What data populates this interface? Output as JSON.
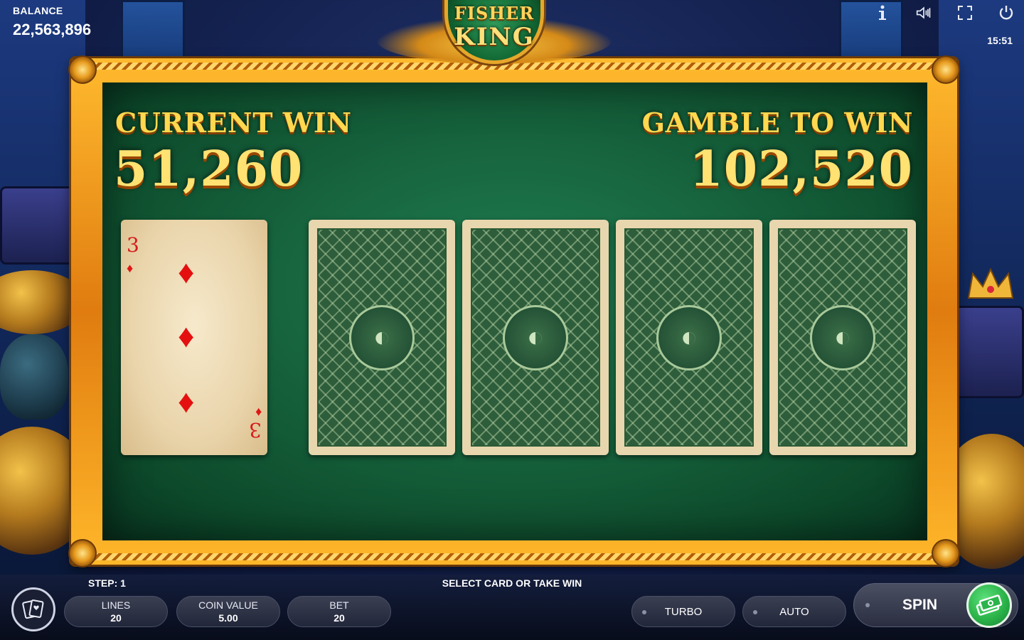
{
  "hud": {
    "balance_label": "BALANCE",
    "balance_value": "22,563,896",
    "clock": "15:51",
    "icons": [
      "info-icon",
      "sound-icon",
      "fullscreen-icon",
      "power-icon"
    ]
  },
  "logo": {
    "line1": "FISHER",
    "line2": "KING"
  },
  "gamble": {
    "current_win_label": "CURRENT WIN",
    "current_win_value": "51,260",
    "gamble_to_win_label": "GAMBLE TO WIN",
    "gamble_to_win_value": "102,520"
  },
  "dealer_card": {
    "rank": "3",
    "suit": "♦",
    "suit_name": "diamonds"
  },
  "hidden_cards_count": 4,
  "bottom": {
    "step": "STEP: 1",
    "hint": "SELECT CARD OR TAKE WIN",
    "lines_label": "LINES",
    "lines_value": "20",
    "coin_value_label": "COIN VALUE",
    "coin_value": "5.00",
    "bet_label": "BET",
    "bet_value": "20",
    "turbo_label": "TURBO",
    "auto_label": "AUTO",
    "spin_label": "SPIN"
  },
  "colors": {
    "felt": "#17653f",
    "gold": "#ffd84f",
    "frame": "#e07c10",
    "spin_green": "#2bb44a"
  }
}
